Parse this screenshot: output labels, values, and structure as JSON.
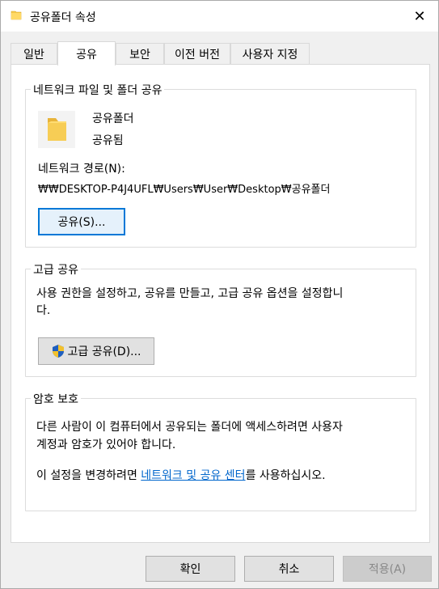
{
  "window": {
    "title": "공유폴더 속성",
    "close_glyph": "✕"
  },
  "tabs": [
    {
      "label": "일반"
    },
    {
      "label": "공유"
    },
    {
      "label": "보안"
    },
    {
      "label": "이전 버전"
    },
    {
      "label": "사용자 지정"
    }
  ],
  "network_sharing": {
    "group_label": "네트워크 파일 및 폴더 공유",
    "folder_name": "공유폴더",
    "folder_status": "공유됨",
    "path_label": "네트워크 경로(N):",
    "path_value": "₩₩DESKTOP-P4J4UFL₩Users₩User₩Desktop₩공유폴더",
    "share_button": "공유(S)..."
  },
  "advanced_sharing": {
    "group_label": "고급 공유",
    "description": "사용 권한을 설정하고, 공유를 만들고, 고급 공유 옵션을 설정합니",
    "description_wrap": "다.",
    "button": "고급 공유(D)..."
  },
  "password_protection": {
    "group_label": "암호 보호",
    "line1": "다른 사람이 이 컴퓨터에서 공유되는 폴더에 액세스하려면 사용자",
    "line2": "계정과 암호가 있어야 합니다.",
    "settings_prefix": "이 설정을 변경하려면 ",
    "settings_link": "네트워크 및 공유 센터",
    "settings_suffix": "를 사용하십시오."
  },
  "footer": {
    "ok": "확인",
    "cancel": "취소",
    "apply": "적용(A)"
  },
  "colors": {
    "accent": "#0078d7",
    "link": "#0066cc",
    "folder": "#f5c84b"
  }
}
